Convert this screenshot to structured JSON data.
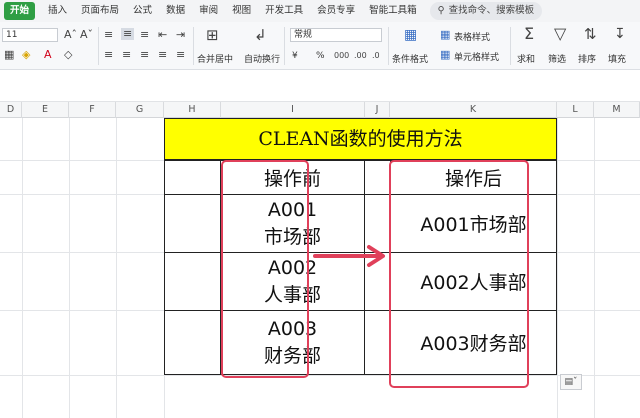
{
  "menubar": {
    "items": [
      "开始",
      "插入",
      "页面布局",
      "公式",
      "数据",
      "审阅",
      "视图",
      "开发工具",
      "会员专享",
      "智能工具箱"
    ],
    "search": "查找命令、搜索模板"
  },
  "ribbon": {
    "font_size": "11",
    "number_format": "常规",
    "merge_center": "合并居中",
    "wrap_text": "自动换行",
    "currency": "¥",
    "percent": "%",
    "conditional_format": "条件格式",
    "table_style": "表格样式",
    "cell_style": "单元格样式",
    "sum": "求和",
    "filter": "筛选",
    "sort": "排序",
    "fill": "填充"
  },
  "columns": [
    "D",
    "E",
    "F",
    "G",
    "H",
    "I",
    "J",
    "K",
    "L",
    "M"
  ],
  "table": {
    "title": "CLEAN函数的使用方法",
    "header_before": "操作前",
    "header_after": "操作后",
    "rows": [
      {
        "before_line1": "A001",
        "before_line2": "市场部",
        "after": "A001市场部"
      },
      {
        "before_line1": "A002",
        "before_line2": "人事部",
        "after": "A002人事部"
      },
      {
        "before_line1": "A003",
        "before_line2": "财务部",
        "after": "A003财务部"
      }
    ]
  },
  "colors": {
    "title_fill": "#ffff00",
    "highlight": "#e0405a",
    "active_tab": "#2f9e44"
  }
}
